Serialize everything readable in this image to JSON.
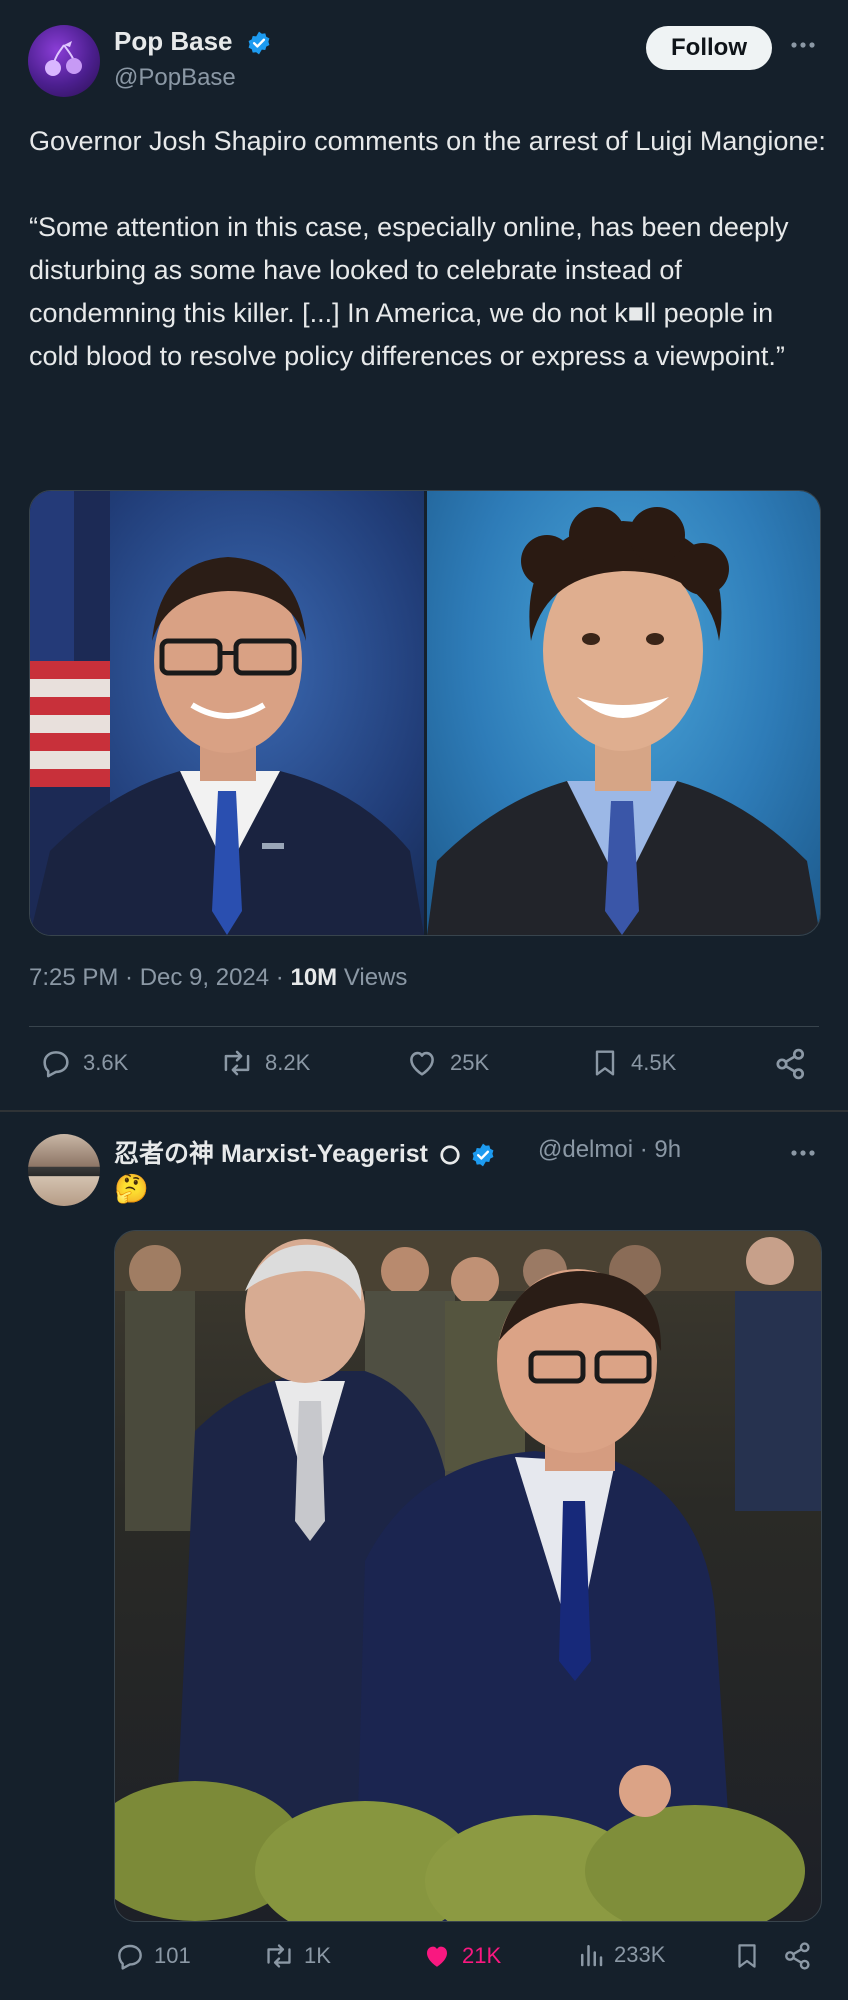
{
  "post1": {
    "author_name": "Pop Base",
    "author_handle": "@PopBase",
    "follow_label": "Follow",
    "text": "Governor Josh Shapiro comments on the arrest of Luigi Mangione:\n\n“Some attention in this case, especially online, has been deeply disturbing as some have looked to celebrate instead of condemning this killer. [...] In America, we do not k■ll people in cold blood to resolve policy differences or express a viewpoint.”",
    "time": "7:25 PM · Dec 9, 2024 · ",
    "views_count": "10M",
    "views_label": " Views",
    "replies": "3.6K",
    "reposts": "8.2K",
    "likes": "25K",
    "bookmarks": "4.5K",
    "icons": [
      "verified-badge-icon",
      "more-icon",
      "reply-icon",
      "repost-icon",
      "like-icon",
      "bookmark-icon",
      "share-icon"
    ]
  },
  "post2": {
    "author_name": "忍者の神 Marxist-Yeagerist",
    "author_handle": "@delmoi · 9h",
    "text": "🤔",
    "replies": "101",
    "reposts": "1K",
    "likes": "21K",
    "views": "233K",
    "icons": [
      "reply-icon",
      "repost-icon",
      "like-icon-filled",
      "views-icon",
      "bookmark-icon",
      "share-icon"
    ]
  },
  "colors": {
    "background": "#15202b",
    "text": "#e7e9ea",
    "muted": "#8b98a5",
    "verified": "#1d9bf0",
    "liked": "#f91880",
    "follow_bg": "#eff3f4"
  }
}
